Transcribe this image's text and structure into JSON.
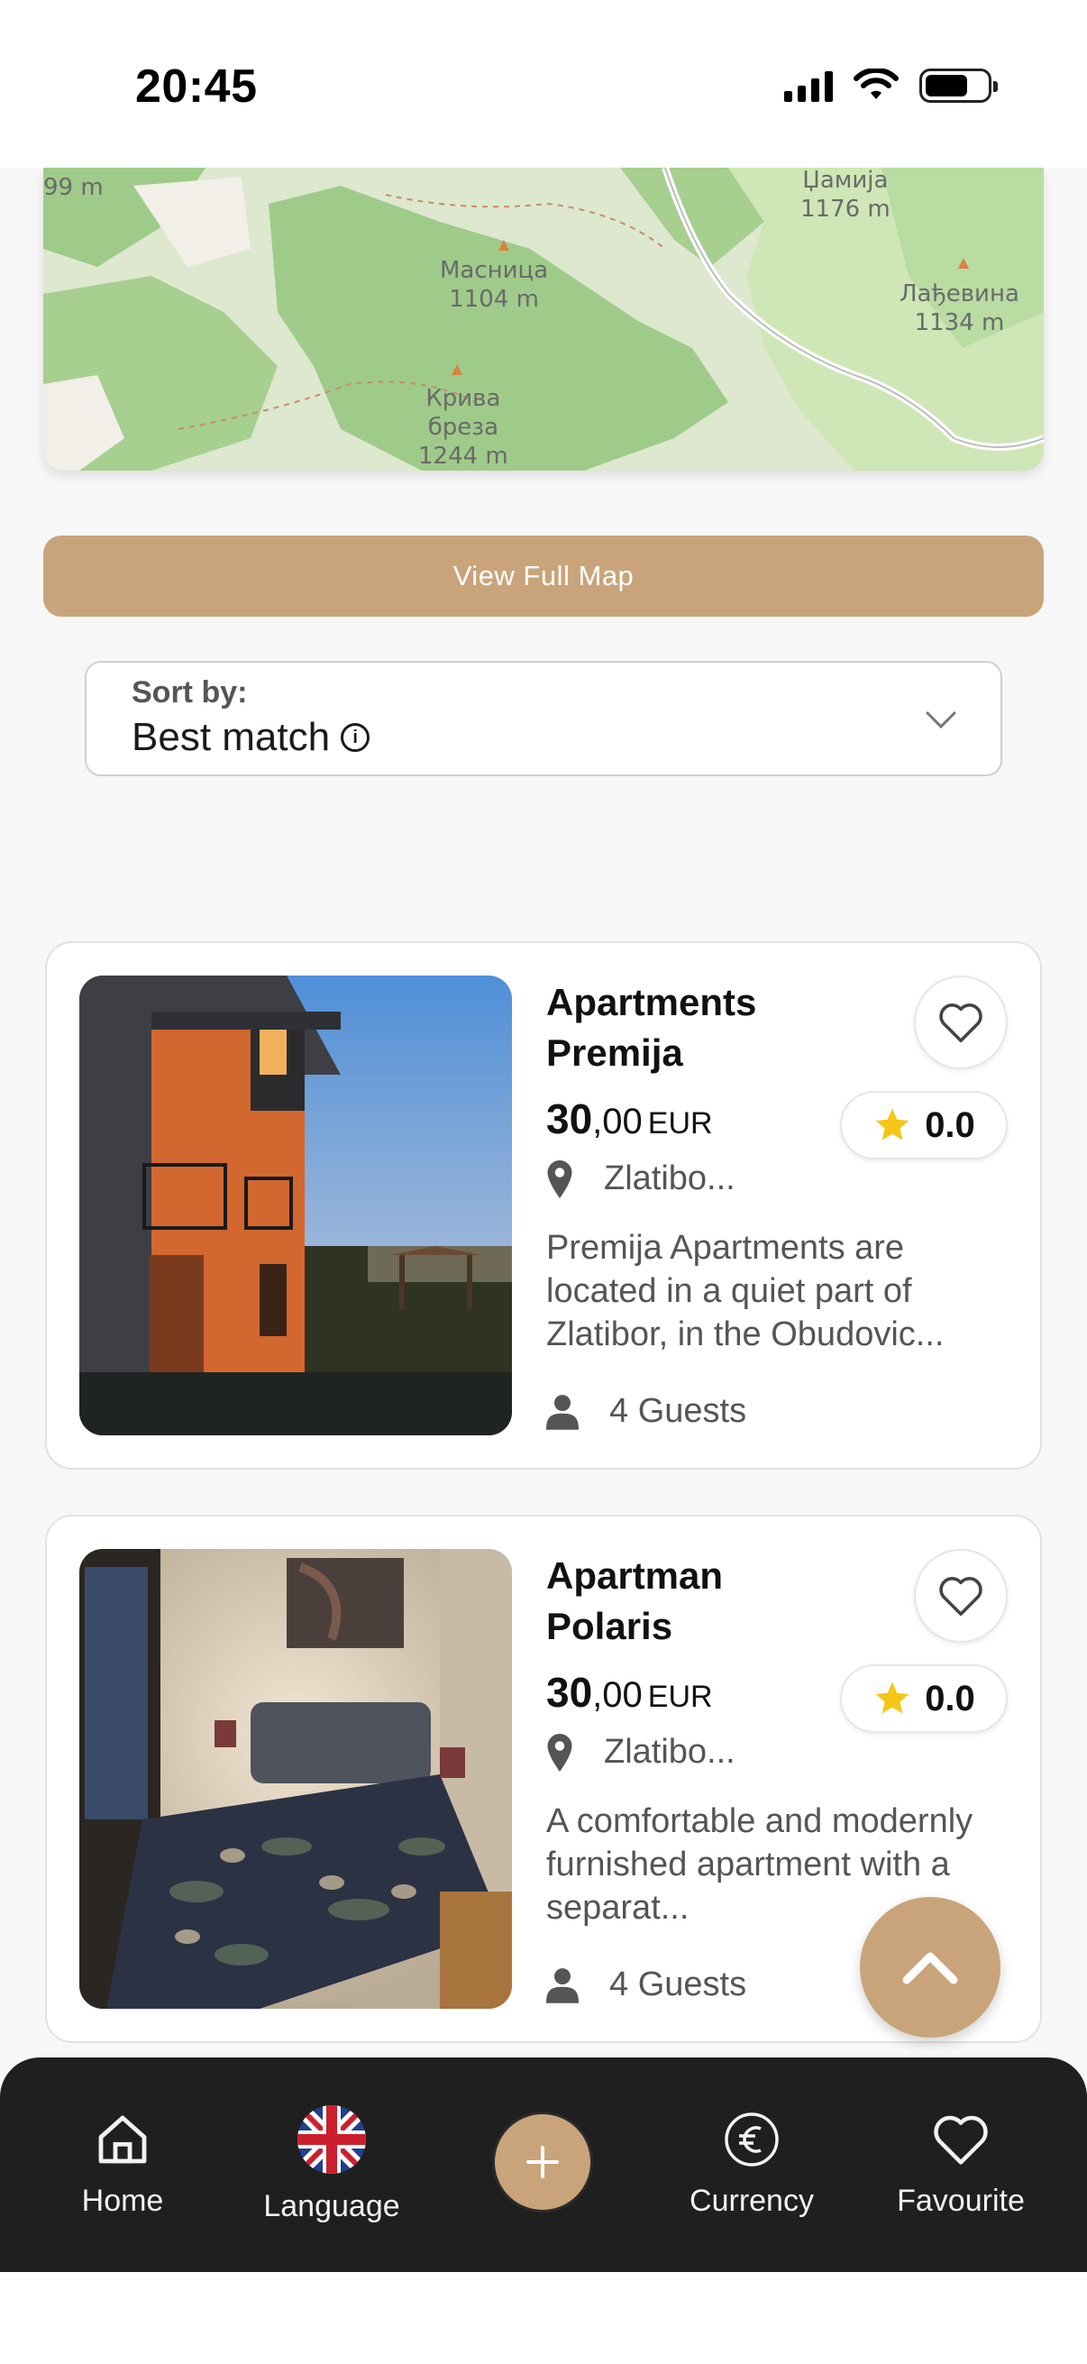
{
  "status_bar": {
    "time": "20:45"
  },
  "map": {
    "labels": [
      {
        "name": "99 m"
      },
      {
        "name": "Џамија",
        "elev": "1176 m"
      },
      {
        "name": "Масница",
        "elev": "1104 m"
      },
      {
        "name": "Лађевина",
        "elev": "1134 m"
      },
      {
        "name": "Крива",
        "elev2": "бреза",
        "elev": "1244 m"
      }
    ]
  },
  "view_map_label": "View Full Map",
  "sort": {
    "label": "Sort by:",
    "value": "Best match"
  },
  "listings": [
    {
      "title_line1": "Apartments",
      "title_line2": "Premija",
      "price_int": "30",
      "price_dec": ",00",
      "currency": "EUR",
      "rating": "0.0",
      "location": "Zlatibo...",
      "description": "Premija Apartments are located in a quiet part of Zlatibor, in the Obudovic...",
      "guests": "4 Guests"
    },
    {
      "title_line1": "Apartman",
      "title_line2": "Polaris",
      "price_int": "30",
      "price_dec": ",00",
      "currency": "EUR",
      "rating": "0.0",
      "location": "Zlatibo...",
      "description": "A comfortable and modernly furnished apartment with a separat...",
      "guests": "4 Guests"
    }
  ],
  "bottom_nav": {
    "home": "Home",
    "language": "Language",
    "currency": "Currency",
    "favourite": "Favourite"
  },
  "colors": {
    "accent": "#c9a47a",
    "nav_bg": "#1f1f1f",
    "star": "#f5c518"
  }
}
